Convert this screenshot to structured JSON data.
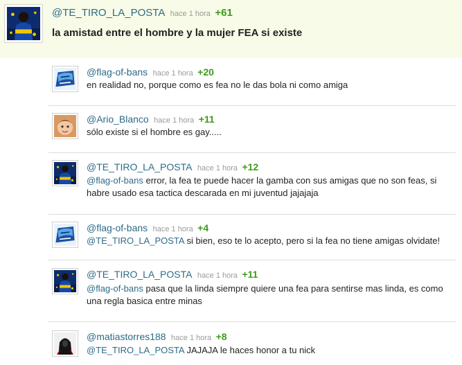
{
  "main_post": {
    "username": "@TE_TIRO_LA_POSTA",
    "time": "hace 1 hora",
    "score": "+61",
    "text": "la amistad entre el hombre y la mujer FEA si existe",
    "avatar_icon": "boca-juniors-player-avatar"
  },
  "replies": [
    {
      "username": "@flag-of-bans",
      "time": "hace 1 hora",
      "score": "+20",
      "mention": "",
      "text": "en realidad no, porque como es fea no le das bola ni como amiga",
      "avatar_icon": "blue-logo-avatar"
    },
    {
      "username": "@Ario_Blanco",
      "time": "hace 1 hora",
      "score": "+11",
      "mention": "",
      "text": "sólo existe si el hombre es gay.....",
      "avatar_icon": "baby-face-avatar"
    },
    {
      "username": "@TE_TIRO_LA_POSTA",
      "time": "hace 1 hora",
      "score": "+12",
      "mention": "@flag-of-bans",
      "text": " error, la fea te puede hacer la gamba con sus amigas que no son feas, si habre usado esa tactica descarada en mi juventud jajajaja",
      "avatar_icon": "boca-juniors-player-avatar"
    },
    {
      "username": "@flag-of-bans",
      "time": "hace 1 hora",
      "score": "+4",
      "mention": "@TE_TIRO_LA_POSTA",
      "text": " si bien, eso te lo acepto, pero si la fea no tiene amigas olvidate!",
      "avatar_icon": "blue-logo-avatar"
    },
    {
      "username": "@TE_TIRO_LA_POSTA",
      "time": "hace 1 hora",
      "score": "+11",
      "mention": "@flag-of-bans",
      "text": " pasa que la linda siempre quiere una fea para sentirse mas linda, es como una regla basica entre minas",
      "avatar_icon": "boca-juniors-player-avatar"
    },
    {
      "username": "@matiastorres188",
      "time": "hace 1 hora",
      "score": "+8",
      "mention": "@TE_TIRO_LA_POSTA",
      "text": " JAJAJA le haces honor a tu nick",
      "avatar_icon": "hooded-figure-avatar"
    }
  ],
  "colors": {
    "username": "#2d6b87",
    "score": "#3d9a1a",
    "time": "#9a9a9a",
    "main_bg": "#f7fbe7",
    "divider": "#dcdcdc"
  }
}
